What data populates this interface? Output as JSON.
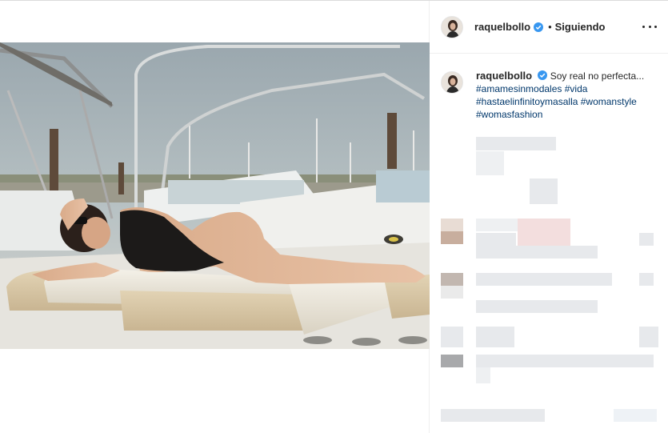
{
  "header": {
    "username": "raquelbollo",
    "separator": "•",
    "follow_status": "Siguiendo"
  },
  "caption": {
    "username": "raquelbollo",
    "text": "Soy real no perfecta...",
    "hashtags_line1": "#amamesinmodales",
    "hashtags_line1b": "#vida",
    "hashtags_line2": "#hastaelinfinitoymasalla",
    "hashtags_line2b": "#womanstyle",
    "hashtags_line3": "#womasfashion"
  },
  "colors": {
    "accent_link": "#00376b",
    "verified_badge": "#3897f0",
    "border": "#dbdbdb"
  },
  "icons": [
    "verified-icon",
    "more-options-icon"
  ]
}
